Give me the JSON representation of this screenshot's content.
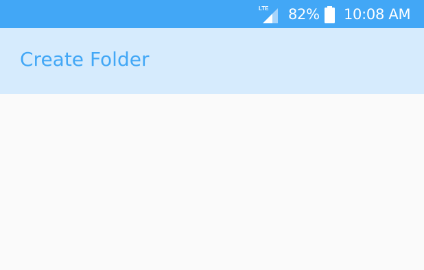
{
  "status_bar": {
    "network_type": "LTE",
    "network_icon": "signal-bars-icon",
    "battery_percent": "82%",
    "battery_icon": "battery-icon",
    "time": "10:08 AM"
  },
  "app_bar": {
    "title": "Create Folder"
  },
  "colors": {
    "status_bar": "#42a7f6",
    "app_bar": "#d6ebfd",
    "title": "#42a7f6",
    "content_background": "#fafafa"
  }
}
